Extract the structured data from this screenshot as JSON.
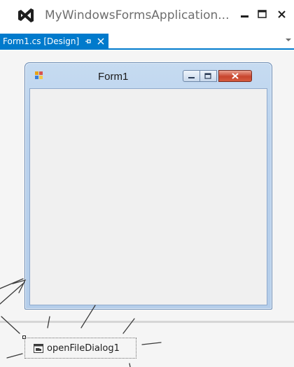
{
  "window": {
    "title": "MyWindowsFormsApplication...",
    "logo_icon": "visual-studio-logo",
    "controls": [
      "minimize-icon",
      "maximize-icon",
      "close-icon"
    ]
  },
  "document_tabs": {
    "active_tab": "Form1.cs [Design]",
    "pin_icon": "pin-icon",
    "close_icon": "close-icon",
    "overflow_icon": "chevron-down-icon"
  },
  "designer": {
    "form": {
      "title": "Form1",
      "icon": "form-icon",
      "controls": [
        "minimize-icon",
        "maximize-icon",
        "close-icon"
      ]
    },
    "component_tray": {
      "items": [
        {
          "label": "openFileDialog1",
          "icon": "openfiledialog-icon"
        }
      ]
    }
  },
  "colors": {
    "accent": "#007acc",
    "designer_background": "#f5f5f5",
    "form_frame": "#b9d1ec",
    "form_close_button": "#c8452d"
  }
}
